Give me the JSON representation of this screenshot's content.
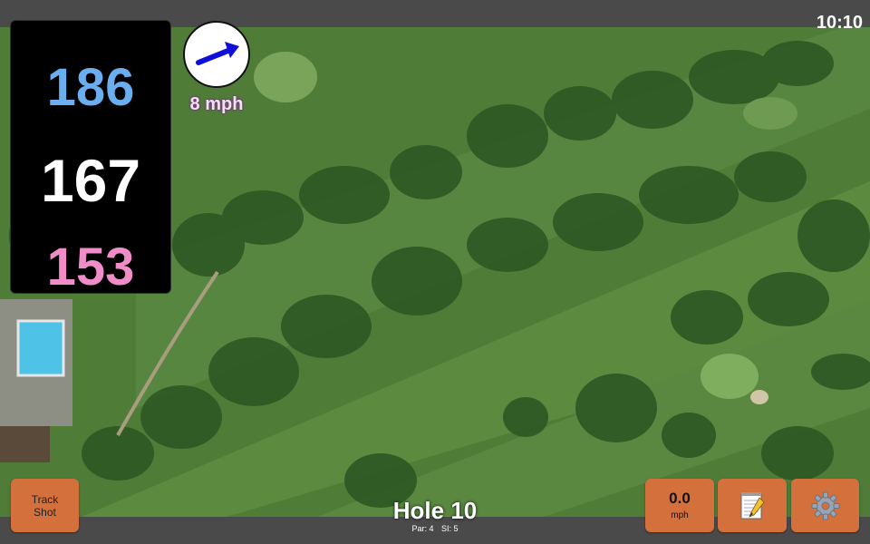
{
  "status": {
    "time": "10:10"
  },
  "distances": {
    "back": "186",
    "middle": "167",
    "front": "153"
  },
  "wind": {
    "label": "8 mph"
  },
  "buttons": {
    "track_shot": [
      "Track",
      "Shot"
    ],
    "speed_value": "0.0",
    "speed_unit": "mph"
  },
  "hole": {
    "title": "Hole 10",
    "par": "Par: 4",
    "si": "SI: 5"
  },
  "colors": {
    "back": "#6aaef0",
    "middle": "#ffffff",
    "front": "#f08cc8",
    "button": "#d4703c",
    "bar": "#4a4a4a"
  },
  "icons": {
    "wind": "wind-arrow-icon",
    "notes": "notepad-icon",
    "settings": "gear-icon"
  }
}
